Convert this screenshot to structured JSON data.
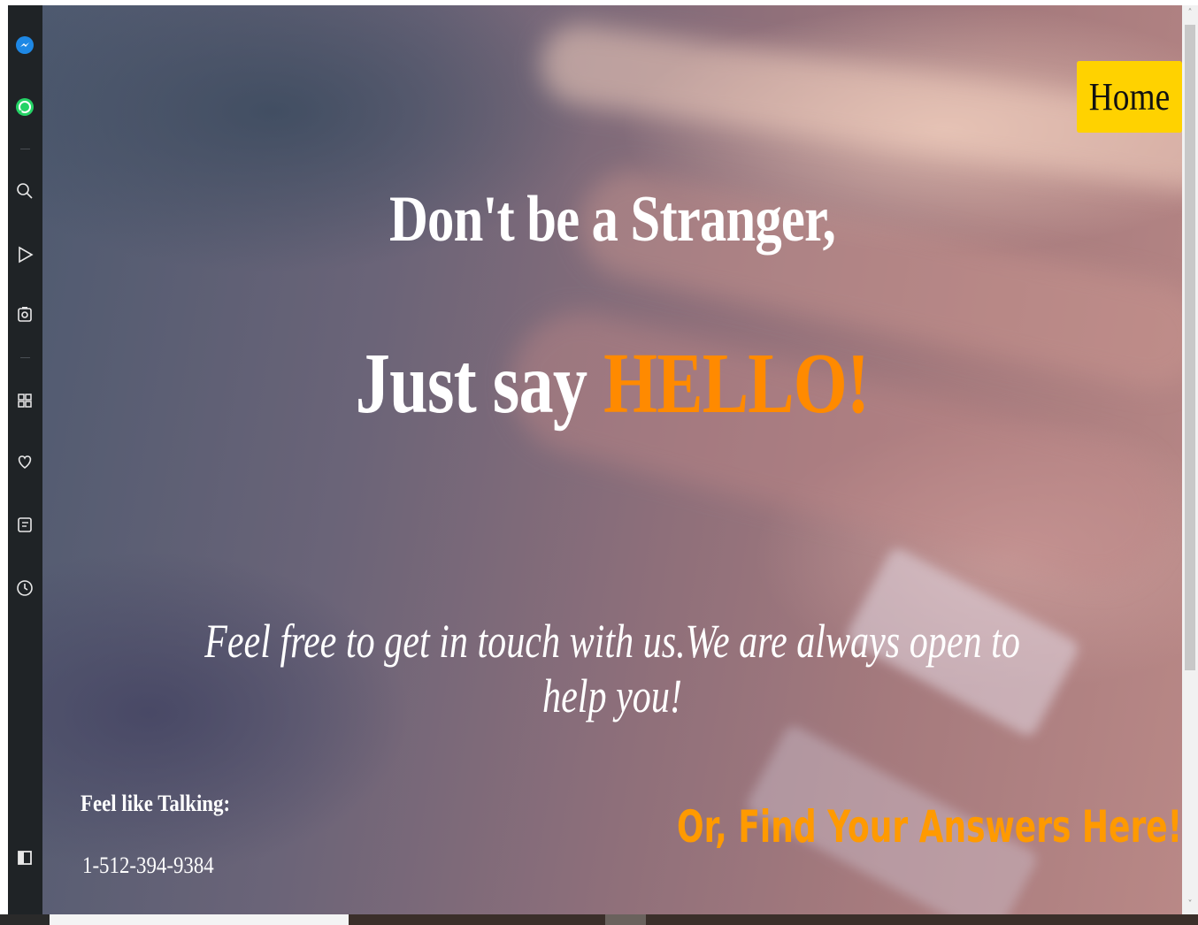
{
  "sidebar": {
    "icons": [
      "messenger-icon",
      "whatsapp-icon",
      "search-icon",
      "play-icon",
      "camera-icon",
      "apps-icon",
      "heart-icon",
      "notes-icon",
      "history-icon",
      "sidebar-toggle-icon"
    ]
  },
  "nav": {
    "home_label": "Home"
  },
  "hero": {
    "heading_line1": "Don't be a Stranger,",
    "heading_line2_prefix": "Just say ",
    "heading_line2_accent": "HELLO!",
    "tagline": "Feel free to get in touch with us.We are always open to help you!"
  },
  "contact": {
    "talk_label": "Feel like Talking:",
    "phone": "1-512-394-9384"
  },
  "answers_link": "Or, Find Your Answers Here!",
  "colors": {
    "accent_orange": "#ff8a00",
    "home_button": "#ffd200",
    "sidebar_bg": "#1f2326"
  }
}
